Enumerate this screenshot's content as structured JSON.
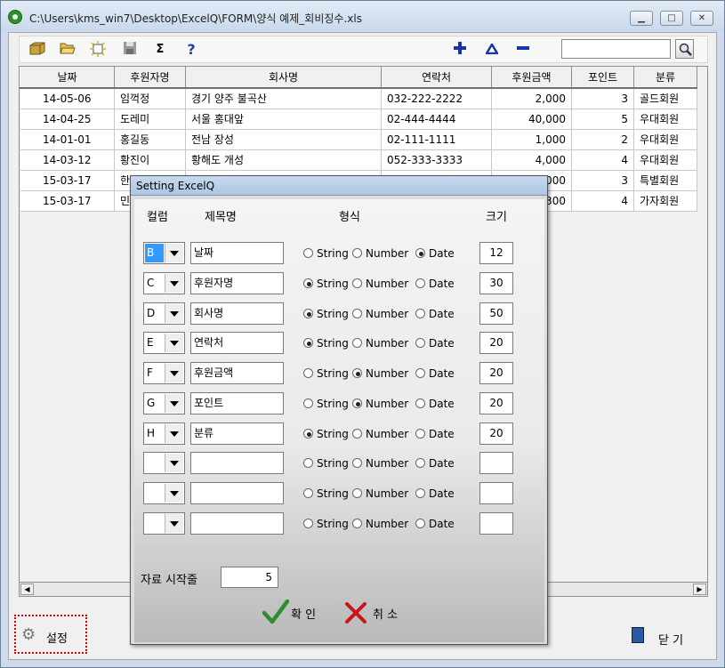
{
  "window": {
    "title": "C:\\Users\\kms_win7\\Desktop\\ExcelQ\\FORM\\양식 예제_회비징수.xls",
    "minimize_icon": "minimize-icon",
    "maximize_icon": "maximize-icon",
    "close_icon": "close-icon"
  },
  "toolbar": {
    "icons": [
      "open-folder-icon",
      "folder-icon",
      "new-icon",
      "save-icon",
      "sum-icon",
      "help-icon",
      "add-icon",
      "up-icon",
      "remove-icon",
      "search-icon"
    ],
    "sum_glyph": "Σ",
    "help_glyph": "?",
    "search_value": ""
  },
  "grid": {
    "columns": [
      "날짜",
      "후원자명",
      "회사명",
      "연락처",
      "후원금액",
      "포인트",
      "분류"
    ],
    "rows": [
      [
        "14-05-06",
        "임꺽정",
        "경기 양주 불곡산",
        "032-222-2222",
        "2,000",
        "3",
        "골드회원"
      ],
      [
        "14-04-25",
        "도레미",
        "서울 홍대앞",
        "02-444-4444",
        "40,000",
        "5",
        "우대회원"
      ],
      [
        "14-01-01",
        "홍길동",
        "전남 장성",
        "02-111-1111",
        "1,000",
        "2",
        "우대회원"
      ],
      [
        "14-03-12",
        "황진이",
        "황해도 개성",
        "052-333-3333",
        "4,000",
        "4",
        "우대회원"
      ],
      [
        "15-03-17",
        "한",
        "",
        "",
        "000",
        "3",
        "특별회원"
      ],
      [
        "15-03-17",
        "민",
        "",
        "",
        "300",
        "4",
        "가자회원"
      ]
    ]
  },
  "bottom": {
    "setting_label": "설정",
    "close_label": "닫 기"
  },
  "dialog": {
    "title": "Setting ExcelQ",
    "headers": {
      "column": "컬럼",
      "title": "제목명",
      "format": "형식",
      "size": "크기"
    },
    "format_options": [
      "String",
      "Number",
      "Date"
    ],
    "rows": [
      {
        "col": "B",
        "title": "날짜",
        "format": "Date",
        "size": "12",
        "selected": true
      },
      {
        "col": "C",
        "title": "후원자명",
        "format": "String",
        "size": "30"
      },
      {
        "col": "D",
        "title": "회사명",
        "format": "String",
        "size": "50"
      },
      {
        "col": "E",
        "title": "연락처",
        "format": "String",
        "size": "20"
      },
      {
        "col": "F",
        "title": "후원금액",
        "format": "Number",
        "size": "20"
      },
      {
        "col": "G",
        "title": "포인트",
        "format": "Number",
        "size": "20"
      },
      {
        "col": "H",
        "title": "분류",
        "format": "String",
        "size": "20"
      },
      {
        "col": "",
        "title": "",
        "format": "",
        "size": ""
      },
      {
        "col": "",
        "title": "",
        "format": "",
        "size": ""
      },
      {
        "col": "",
        "title": "",
        "format": "",
        "size": ""
      }
    ],
    "start_row_label": "자료 시작줄",
    "start_row_value": "5",
    "ok_label": "확 인",
    "cancel_label": "취 소"
  }
}
